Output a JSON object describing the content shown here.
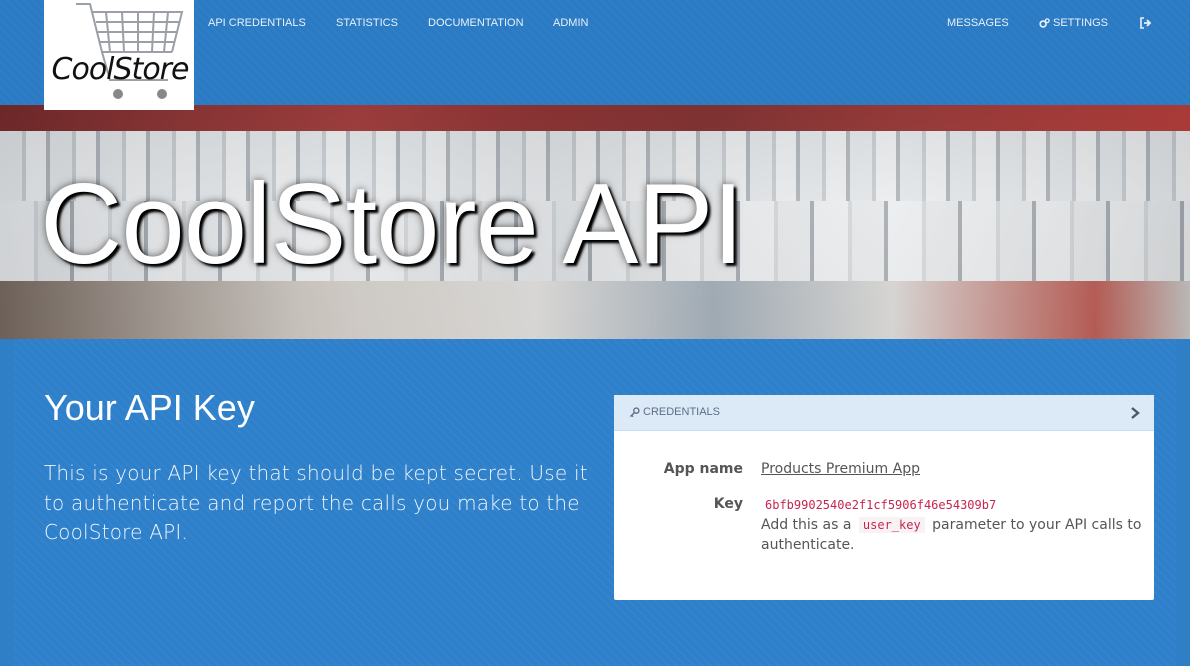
{
  "brand": {
    "logo_text": "CoolStore"
  },
  "nav": {
    "left": [
      "API CREDENTIALS",
      "STATISTICS",
      "DOCUMENTATION",
      "ADMIN"
    ],
    "messages": "MESSAGES",
    "settings": "SETTINGS",
    "icons": {
      "settings": "gears-icon",
      "logout": "sign-out-icon"
    }
  },
  "hero": {
    "title": "CoolStore API"
  },
  "intro": {
    "heading": "Your API Key",
    "description": "This is your API key that should be kept secret. Use it to authenticate and report the calls you make to the CoolStore API."
  },
  "credentials": {
    "header": "CREDENTIALS",
    "app_name_label": "App name",
    "app_name_value": "Products Premium App",
    "key_label": "Key",
    "key_value": "6bfb9902540e2f1cf5906f46e54309b7",
    "hint_before": "Add this as a",
    "hint_code": "user_key",
    "hint_after": "parameter to your API calls to authenticate.",
    "icons": {
      "header": "key-icon",
      "expand": "chevron-right-icon"
    }
  },
  "colors": {
    "nav_bg": "#2a7bc4",
    "main_bg": "#2e80cb",
    "code": "#c7254e"
  }
}
